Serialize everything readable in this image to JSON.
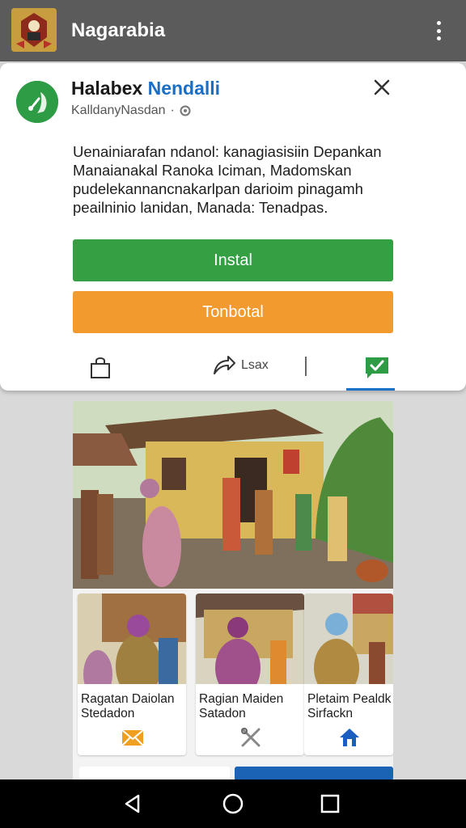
{
  "appbar": {
    "title": "Nagarabia",
    "logo_icon": "crest-logo-icon",
    "menu_icon": "more-vert-icon"
  },
  "dialog": {
    "app_name_prefix": "Halabex ",
    "app_name_accent": "Nendalli",
    "developer": "KalldanyNasdan",
    "developer_separator": "·",
    "close_icon": "close-icon",
    "description": "Uenainiarafan ndanol:  kanagiasisiin Depankan Manaianakal Ranoka Iciman, Madomskan pudelekannancnakarlpan darioim pinagamh peailninio lanidan, Manada: Tenadpas.",
    "install_label": "Instal",
    "secondary_label": "Tonbotal",
    "share_label": "Lsax",
    "colors": {
      "install": "#34a043",
      "secondary": "#f29a2e",
      "accent": "#1a6fc4",
      "appbar": "#5b5b5b"
    }
  },
  "feed": {
    "items": [
      {
        "caption": "Ragatan Daiolan Stedadon",
        "icon": "envelope-icon"
      },
      {
        "caption": "Ragian Maiden Satadon",
        "icon": "tools-icon"
      },
      {
        "caption": "Pletaim Pealdk Sirfackn",
        "icon": "home-icon"
      }
    ]
  },
  "navbar": {
    "back_icon": "back-icon",
    "home_icon": "home-circle-icon",
    "recents_icon": "recents-icon"
  }
}
